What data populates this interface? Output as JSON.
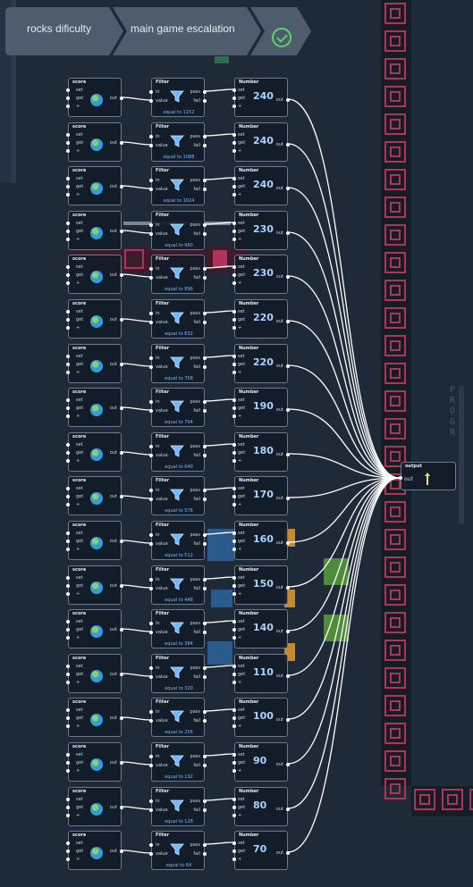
{
  "breadcrumb": {
    "items": [
      {
        "label": "rocks dificulty"
      },
      {
        "label": "main game escalation"
      }
    ],
    "status_icon": "check-icon"
  },
  "node_titles": {
    "score": "score",
    "filter": "Filter",
    "number": "Number",
    "output": "output"
  },
  "port_labels": {
    "set": "set",
    "get": "get",
    "plus": "+",
    "out": "out",
    "in": "in",
    "value": "value",
    "pass": "pass",
    "fail": "fail"
  },
  "rows": [
    {
      "filter_label": "equal to 1152",
      "number": "240"
    },
    {
      "filter_label": "equal to 1088",
      "number": "240"
    },
    {
      "filter_label": "equal to 1024",
      "number": "240"
    },
    {
      "filter_label": "equal to 960",
      "number": "230"
    },
    {
      "filter_label": "equal to 896",
      "number": "230"
    },
    {
      "filter_label": "equal to 832",
      "number": "220"
    },
    {
      "filter_label": "equal to 768",
      "number": "220"
    },
    {
      "filter_label": "equal to 704",
      "number": "190"
    },
    {
      "filter_label": "equal to 640",
      "number": "180"
    },
    {
      "filter_label": "equal to 576",
      "number": "170"
    },
    {
      "filter_label": "equal to 512",
      "number": "160"
    },
    {
      "filter_label": "equal to 448",
      "number": "150"
    },
    {
      "filter_label": "equal to 384",
      "number": "140"
    },
    {
      "filter_label": "equal to 320",
      "number": "110"
    },
    {
      "filter_label": "equal to 256",
      "number": "100"
    },
    {
      "filter_label": "equal to 192",
      "number": "90"
    },
    {
      "filter_label": "equal to 128",
      "number": "80"
    },
    {
      "filter_label": "equal to 64",
      "number": "70"
    }
  ],
  "background_label": "PROGR",
  "colors": {
    "canvas": "#1f2a38",
    "wall": "#b0335a",
    "wire": "#ffffff",
    "accent_green": "#59d36b",
    "value_blue": "#a9d2ff"
  }
}
